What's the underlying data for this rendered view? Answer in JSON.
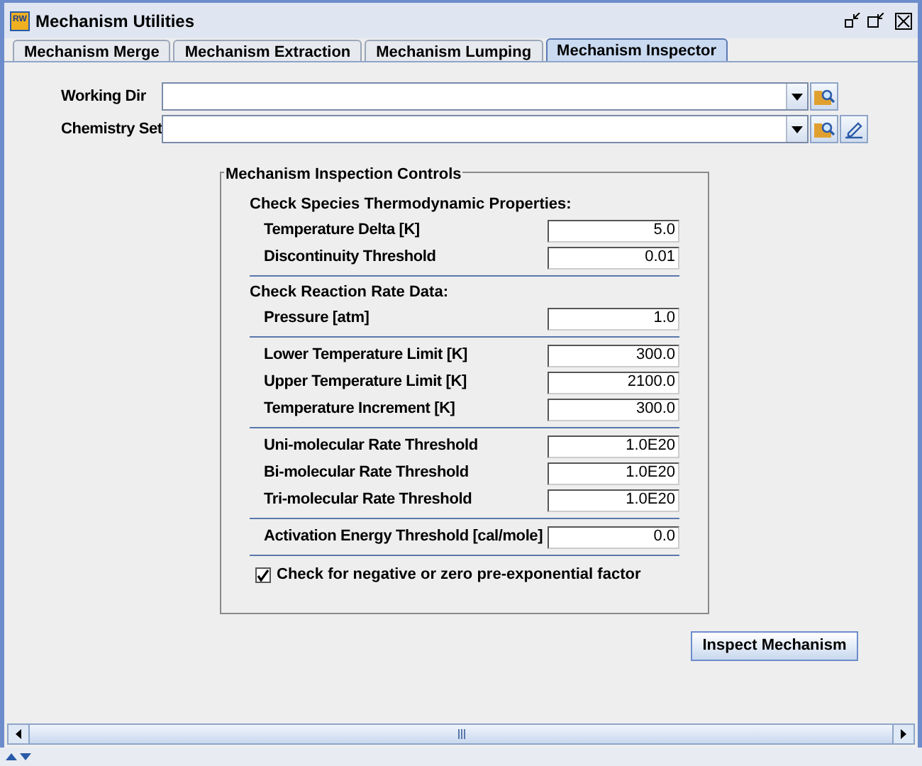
{
  "window": {
    "title": "Mechanism Utilities",
    "app_icon": "RW"
  },
  "tabs": [
    {
      "label": "Mechanism Merge",
      "selected": false
    },
    {
      "label": "Mechanism Extraction",
      "selected": false
    },
    {
      "label": "Mechanism Lumping",
      "selected": false
    },
    {
      "label": "Mechanism Inspector",
      "selected": true
    }
  ],
  "fields": [
    {
      "label": "Working Dir",
      "edit_button": false
    },
    {
      "label": "Chemistry Set",
      "edit_button": true
    }
  ],
  "controls": {
    "title": "Mechanism Inspection Controls",
    "groups": [
      {
        "heading": "Check Species Thermodynamic Properties:",
        "rows": [
          {
            "label": "Temperature Delta [K]",
            "value": "5.0"
          },
          {
            "label": "Discontinuity Threshold",
            "value": "0.01"
          }
        ]
      },
      {
        "heading": "Check Reaction Rate Data:",
        "rows": [
          {
            "label": "Pressure [atm]",
            "value": "1.0"
          }
        ]
      },
      {
        "rows": [
          {
            "label": "Lower Temperature Limit [K]",
            "value": "300.0"
          },
          {
            "label": "Upper Temperature Limit [K]",
            "value": "2100.0"
          },
          {
            "label": "Temperature Increment [K]",
            "value": "300.0"
          }
        ]
      },
      {
        "rows": [
          {
            "label": "Uni-molecular Rate Threshold",
            "value": "1.0E20"
          },
          {
            "label": "Bi-molecular Rate Threshold",
            "value": "1.0E20"
          },
          {
            "label": "Tri-molecular Rate Threshold",
            "value": "1.0E20"
          }
        ]
      },
      {
        "rows": [
          {
            "label": "Activation Energy Threshold [cal/mole]",
            "value": "0.0"
          }
        ]
      }
    ],
    "checkbox": {
      "label": "Check for negative or zero pre-exponential factor",
      "checked": true
    }
  },
  "button": "Inspect Mechanism"
}
